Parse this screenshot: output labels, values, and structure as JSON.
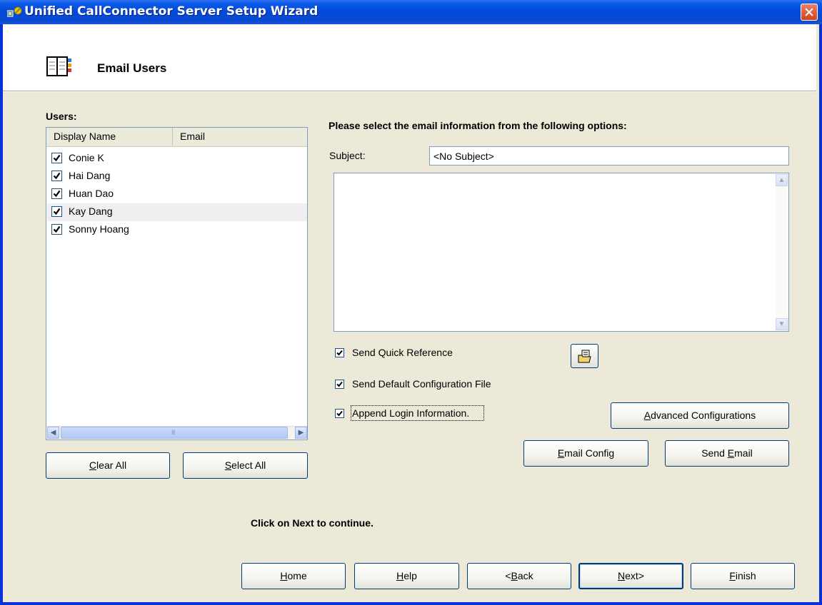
{
  "window": {
    "title": "Unified CallConnector Server Setup Wizard"
  },
  "header": {
    "title": "Email Users",
    "icon": "address-book-icon"
  },
  "users": {
    "label": "Users:",
    "columns": [
      "Display Name",
      "Email"
    ],
    "rows": [
      {
        "name": "Conie K",
        "email": "",
        "checked": true
      },
      {
        "name": "Hai Dang",
        "email": "",
        "checked": true
      },
      {
        "name": "Huan Dao",
        "email": "",
        "checked": true
      },
      {
        "name": "Kay Dang",
        "email": "",
        "checked": true,
        "selected": true
      },
      {
        "name": "Sonny Hoang",
        "email": "",
        "checked": true
      }
    ],
    "scroll_thumb_grip": "III"
  },
  "buttons": {
    "clear_all": {
      "pre": "",
      "u": "C",
      "post": "lear All"
    },
    "select_all": {
      "pre": "",
      "u": "S",
      "post": "elect All"
    },
    "advanced": {
      "pre": "",
      "u": "A",
      "post": "dvanced Configurations"
    },
    "email_config": {
      "pre": "",
      "u": "E",
      "post": "mail Config"
    },
    "send_email": {
      "pre": "Send ",
      "u": "E",
      "post": "mail"
    },
    "home": {
      "pre": "",
      "u": "H",
      "post": "ome"
    },
    "help": {
      "pre": "",
      "u": "H",
      "post": "elp"
    },
    "back": {
      "pre": "<",
      "u": "B",
      "post": "ack"
    },
    "next": {
      "pre": "",
      "u": "N",
      "post": "ext>"
    },
    "finish": {
      "pre": "",
      "u": "F",
      "post": "inish"
    }
  },
  "email": {
    "instruction": "Please select the email information from the following options:",
    "subject_label": "Subject:",
    "subject_value": "<No Subject>",
    "body_value": "",
    "options": [
      {
        "label": "Send Quick Reference",
        "checked": true
      },
      {
        "label": "Send Default Configuration File",
        "checked": true
      },
      {
        "label": "Append Login Information.",
        "checked": true
      }
    ]
  },
  "footer": {
    "instruction": "Click on Next to continue."
  }
}
